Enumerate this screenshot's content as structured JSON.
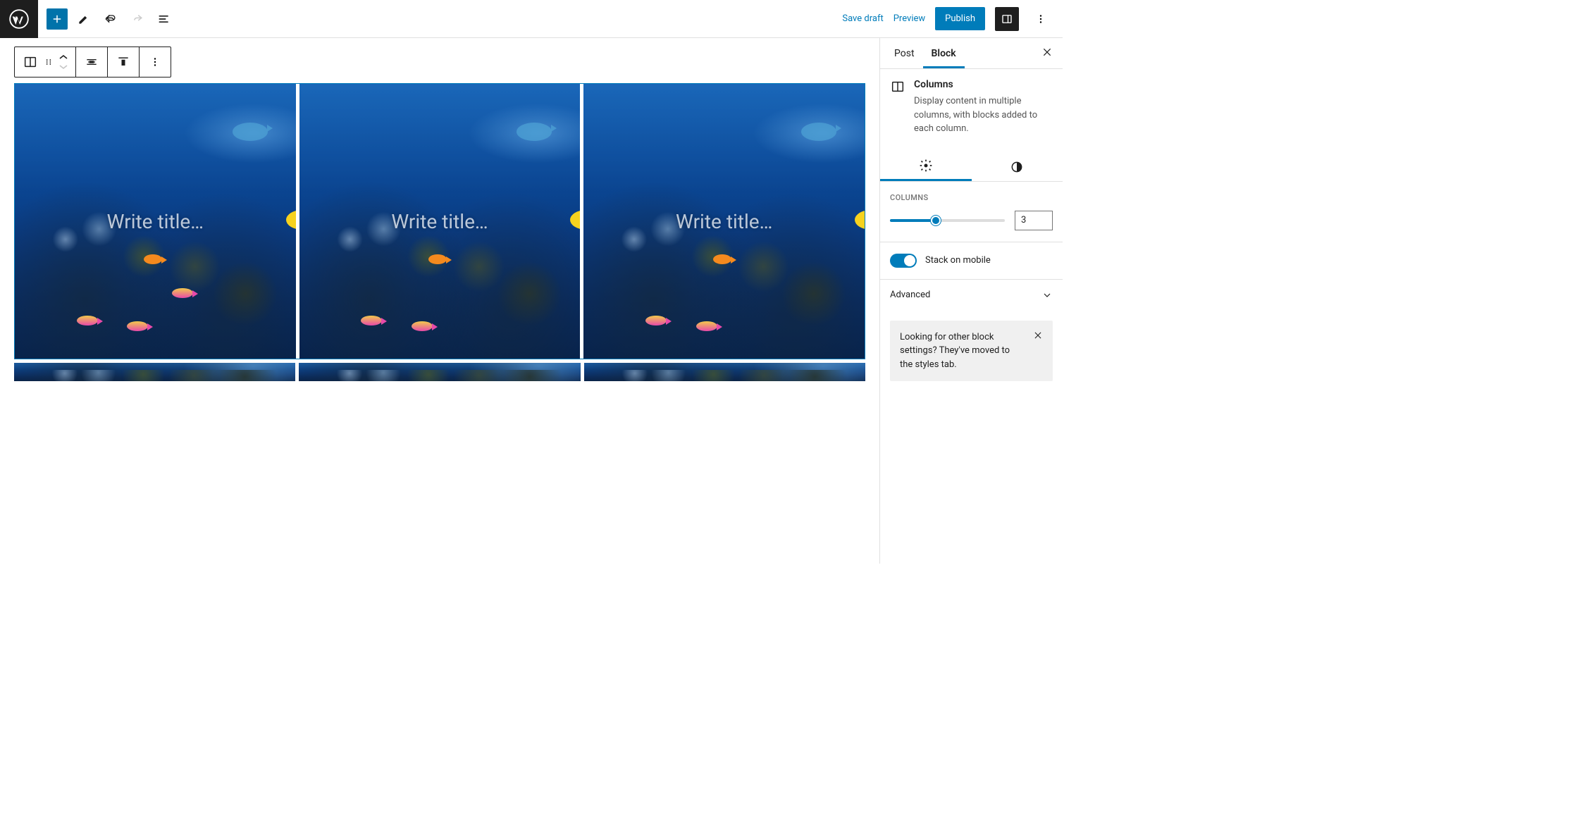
{
  "header": {
    "save_draft": "Save draft",
    "preview": "Preview",
    "publish": "Publish"
  },
  "canvas": {
    "column_placeholder": "Write title…"
  },
  "sidebar": {
    "tabs": {
      "post": "Post",
      "block": "Block"
    },
    "block": {
      "title": "Columns",
      "description": "Display content in multiple columns, with blocks added to each column."
    },
    "columns_setting": {
      "label": "COLUMNS",
      "value": "3",
      "slider_percent": 40
    },
    "stack_toggle": {
      "label": "Stack on mobile",
      "on": true
    },
    "advanced": "Advanced",
    "hint": "Looking for other block settings? They've moved to the styles tab."
  }
}
